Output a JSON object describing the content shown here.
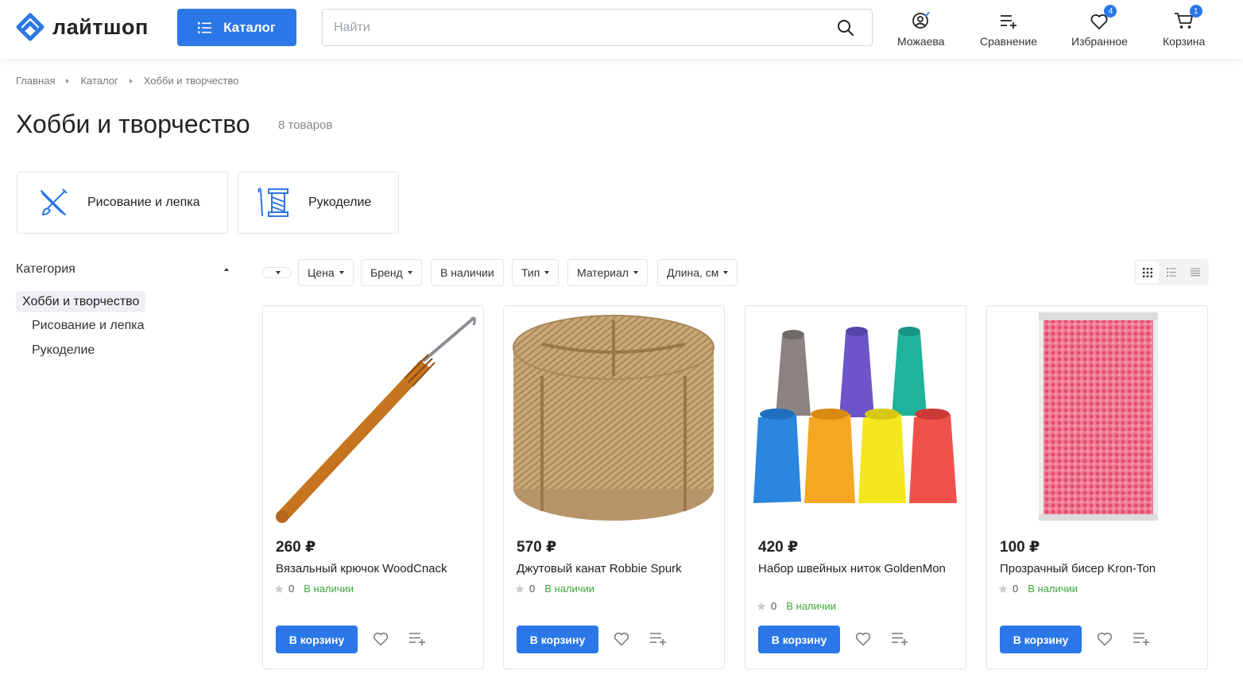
{
  "header": {
    "logo_text": "лайтшоп",
    "catalog_label": "Каталог",
    "search_placeholder": "Найти",
    "account_label": "Можаева",
    "compare_label": "Сравнение",
    "favorites_label": "Избранное",
    "favorites_count": "4",
    "cart_label": "Корзина",
    "cart_count": "1"
  },
  "breadcrumb": [
    "Главная",
    "Каталог",
    "Хобби и творчество"
  ],
  "page": {
    "title": "Хобби и творчество",
    "count": "8 товаров"
  },
  "subcategories": [
    {
      "label": "Рисование и лепка",
      "icon": "brush-pencil-icon"
    },
    {
      "label": "Рукоделие",
      "icon": "thread-spool-icon"
    }
  ],
  "sidebar": {
    "heading": "Категория",
    "active": "Хобби и творчество",
    "items": [
      "Рисование и лепка",
      "Рукоделие"
    ]
  },
  "filters": [
    "Цена",
    "Бренд",
    "В наличии",
    "Тип",
    "Материал",
    "Длина, см"
  ],
  "products": [
    {
      "price": "260 ₽",
      "name": "Вязальный крючок WoodCnack",
      "rating": "0",
      "stock": "В наличии",
      "cart_label": "В корзину",
      "image": "crochet-hook"
    },
    {
      "price": "570 ₽",
      "name": "Джутовый канат Robbie Spurk",
      "rating": "0",
      "stock": "В наличии",
      "cart_label": "В корзину",
      "image": "jute-rope"
    },
    {
      "price": "420 ₽",
      "name": "Набор швейных ниток GoldenMon",
      "rating": "0",
      "stock": "В наличии",
      "cart_label": "В корзину",
      "image": "thread-spools"
    },
    {
      "price": "100 ₽",
      "name": "Прозрачный бисер Kron-Ton",
      "rating": "0",
      "stock": "В наличии",
      "cart_label": "В корзину",
      "image": "beads-bag"
    }
  ],
  "colors": {
    "accent": "#2b77e8",
    "in_stock": "#3da53c"
  }
}
